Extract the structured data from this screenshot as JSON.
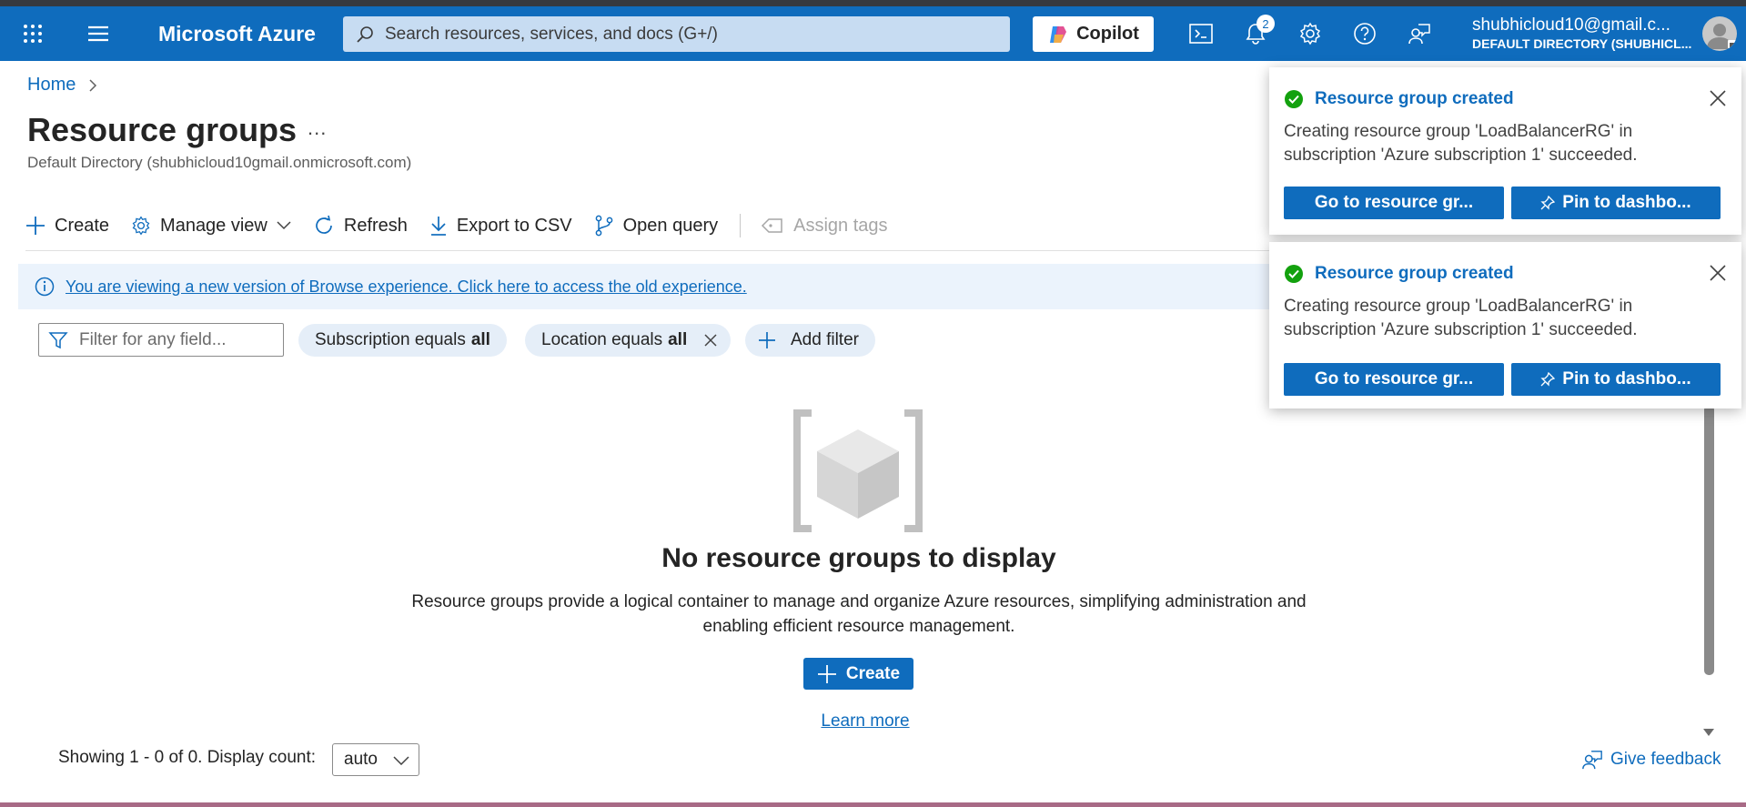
{
  "header": {
    "brand": "Microsoft Azure",
    "search_placeholder": "Search resources, services, and docs (G+/)",
    "copilot_label": "Copilot",
    "notification_count": "2",
    "account_email": "shubhicloud10@gmail.c...",
    "account_directory": "DEFAULT DIRECTORY (SHUBHICL..."
  },
  "breadcrumb": {
    "home": "Home"
  },
  "page": {
    "title": "Resource groups",
    "more": "...",
    "subtitle": "Default Directory (shubhicloud10gmail.onmicrosoft.com)"
  },
  "toolbar": {
    "create": "Create",
    "manage_view": "Manage view",
    "refresh": "Refresh",
    "export_csv": "Export to CSV",
    "open_query": "Open query",
    "assign_tags": "Assign tags"
  },
  "infobar": {
    "text": "You are viewing a new version of Browse experience. Click here to access the old experience."
  },
  "filters": {
    "placeholder": "Filter for any field...",
    "subscription_label": "Subscription equals",
    "subscription_value": "all",
    "location_label": "Location equals",
    "location_value": "all",
    "add_filter": "Add filter"
  },
  "empty_state": {
    "title": "No resource groups to display",
    "description": "Resource groups provide a logical container to manage and organize Azure resources, simplifying administration and enabling efficient resource management.",
    "create": "Create",
    "learn_more": "Learn more"
  },
  "footer": {
    "showing": "Showing 1 - 0 of 0. Display count:",
    "display_count": "auto",
    "feedback": "Give feedback"
  },
  "notifications": [
    {
      "title": "Resource group created",
      "body": "Creating resource group 'LoadBalancerRG' in subscription 'Azure subscription 1' succeeded.",
      "go_button": "Go to resource gr...",
      "pin_button": "Pin to dashbo..."
    },
    {
      "title": "Resource group created",
      "body": "Creating resource group 'LoadBalancerRG' in subscription 'Azure subscription 1' succeeded.",
      "go_button": "Go to resource gr...",
      "pin_button": "Pin to dashbo..."
    }
  ],
  "colors": {
    "azure_blue": "#0f6cbd",
    "success_green": "#13a10e",
    "info_bg": "#ebf3fc",
    "pill_bg": "#e5eef8"
  },
  "icons": [
    "app-launcher-icon",
    "hamburger-menu-icon",
    "search-icon",
    "copilot-icon",
    "cloud-shell-icon",
    "bell-icon",
    "gear-icon",
    "help-icon",
    "feedback-person-icon",
    "avatar-icon",
    "chevron-right-icon",
    "plus-icon",
    "gear-icon",
    "chevron-down-icon",
    "refresh-icon",
    "download-icon",
    "query-branch-icon",
    "tag-icon",
    "info-icon",
    "funnel-icon",
    "close-icon",
    "resource-group-cube-icon",
    "checkmark-circle-icon",
    "pin-icon"
  ]
}
